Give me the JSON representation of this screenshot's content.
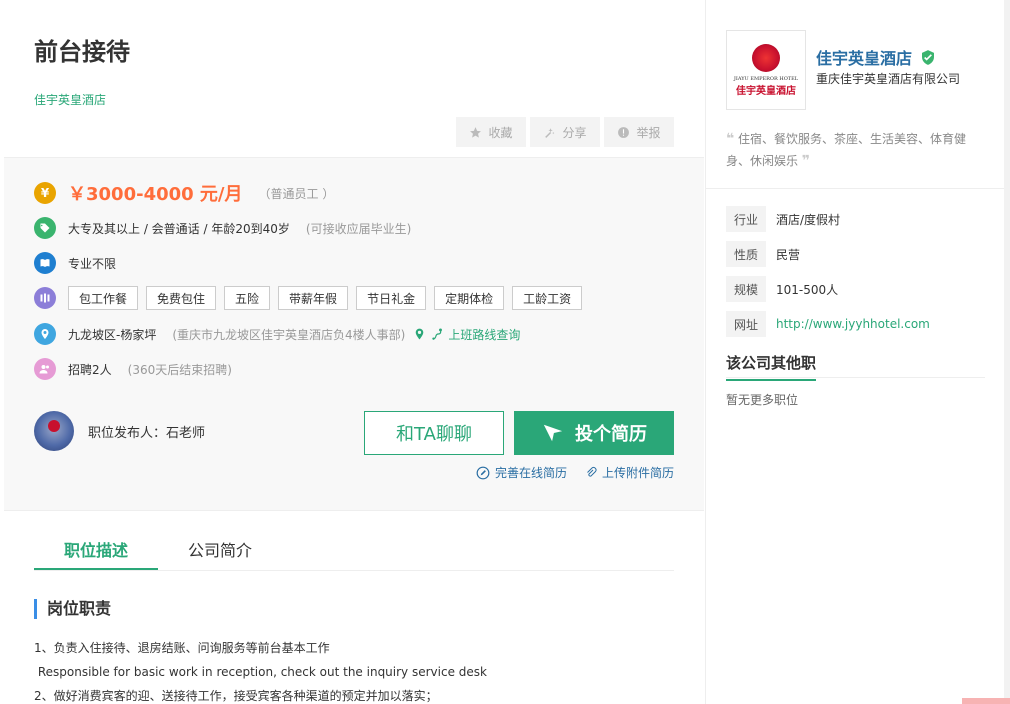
{
  "job": {
    "title": "前台接待",
    "company": "佳宇英皇酒店",
    "actions": {
      "favorite": "收藏",
      "share": "分享",
      "report": "举报"
    },
    "salary": "￥3000-4000 元/月",
    "salary_note": "（普通员工 ）",
    "requirements": "大专及其以上 / 会普通话 / 年龄20到40岁",
    "requirements_note": "(可接收应届毕业生)",
    "major": "专业不限",
    "benefits": [
      "包工作餐",
      "免费包住",
      "五险",
      "带薪年假",
      "节日礼金",
      "定期体检",
      "工龄工资"
    ],
    "location": "九龙坡区-杨家坪",
    "address": "(重庆市九龙坡区佳宇英皇酒店负4楼人事部)",
    "route_link": "上班路线查询",
    "hiring": "招聘2人",
    "hiring_note": "(360天后结束招聘)",
    "publisher": "职位发布人：石老师",
    "chat_btn": "和TA聊聊",
    "apply_btn": "投个简历",
    "improve_resume": "完善在线简历",
    "upload_resume": "上传附件简历"
  },
  "tabs": [
    "职位描述",
    "公司简介"
  ],
  "section_title": "岗位职责",
  "description": [
    "1、负责入住接待、退房结账、问询服务等前台基本工作",
    " Responsible for basic work in reception, check out the inquiry service desk",
    "2、做好消费宾客的迎、送接待工作，接受宾客各种渠道的预定并加以落实；"
  ],
  "company_card": {
    "name": "佳宇英皇酒店",
    "full_name": "重庆佳宇英皇酒店有限公司",
    "logo_en": "JIAYU EMPEROR HOTEL",
    "logo_cn": "佳宇英皇酒店",
    "description": "住宿、餐饮服务、茶座、生活美容、体育健身、休闲娱乐",
    "info": [
      {
        "k": "行业",
        "v": "酒店/度假村"
      },
      {
        "k": "性质",
        "v": "民营"
      },
      {
        "k": "规模",
        "v": "101-500人"
      },
      {
        "k": "网址",
        "v": "http://www.jyyhhotel.com"
      }
    ],
    "other_jobs_title": "该公司其他职",
    "other_jobs_empty": "暂无更多职位"
  },
  "colors": {
    "accent": "#2aa778",
    "salary": "#ff6d3b",
    "link": "#2a6ea3"
  }
}
